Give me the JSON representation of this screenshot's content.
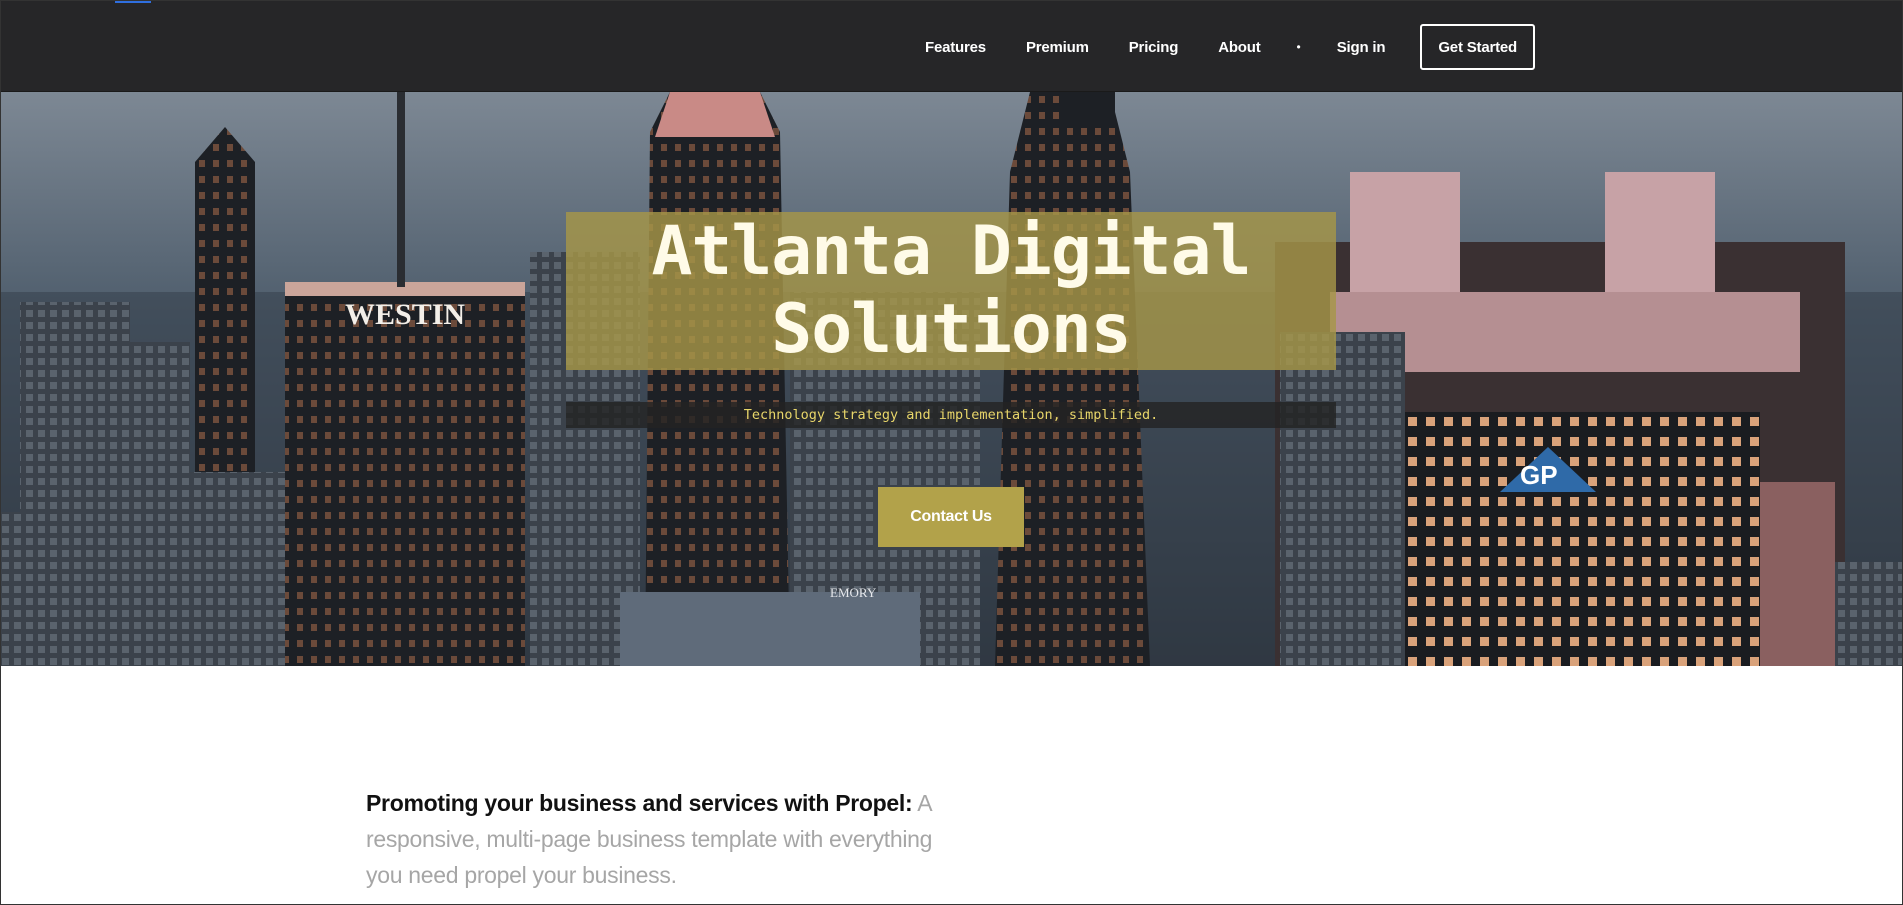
{
  "nav": {
    "items": [
      {
        "label": "Features"
      },
      {
        "label": "Premium"
      },
      {
        "label": "Pricing"
      },
      {
        "label": "About"
      }
    ],
    "separator": "•",
    "signin_label": "Sign in",
    "cta_label": "Get Started"
  },
  "hero": {
    "title_line1": "Atlanta Digital",
    "title_line2": "Solutions",
    "subtitle": "Technology strategy and implementation, simplified.",
    "contact_label": "Contact Us",
    "building_signs": {
      "westin": "WESTIN",
      "emory": "EMORY",
      "gp": "GP"
    }
  },
  "promo": {
    "strong_text": "Promoting your business and services with Propel:",
    "light_text": "A responsive, multi-page business template with everything you need propel your business."
  },
  "colors": {
    "nav_bg": "#262628",
    "title_box": "#a69648",
    "subtitle_text": "#e8d66a",
    "contact_button": "#b2a24a"
  }
}
